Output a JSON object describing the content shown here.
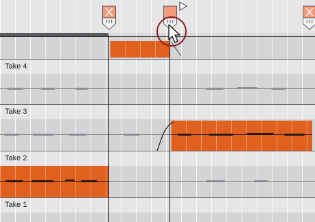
{
  "tracks": {
    "take_4_label": "Take 4",
    "take_3_label": "Take 3",
    "take_2_label": "Take 2",
    "take_1_label": "Take 1"
  },
  "colors": {
    "region_fill": "#e0601d",
    "marker_fill": "#f39b7a",
    "highlight_ring": "#8c1a1a",
    "background": "#dadadd"
  },
  "icons": {
    "comp_marker": "comp-boundary-marker-icon",
    "mouse_pointer": "mouse-pointer-icon",
    "highlight": "highlight-circle"
  }
}
